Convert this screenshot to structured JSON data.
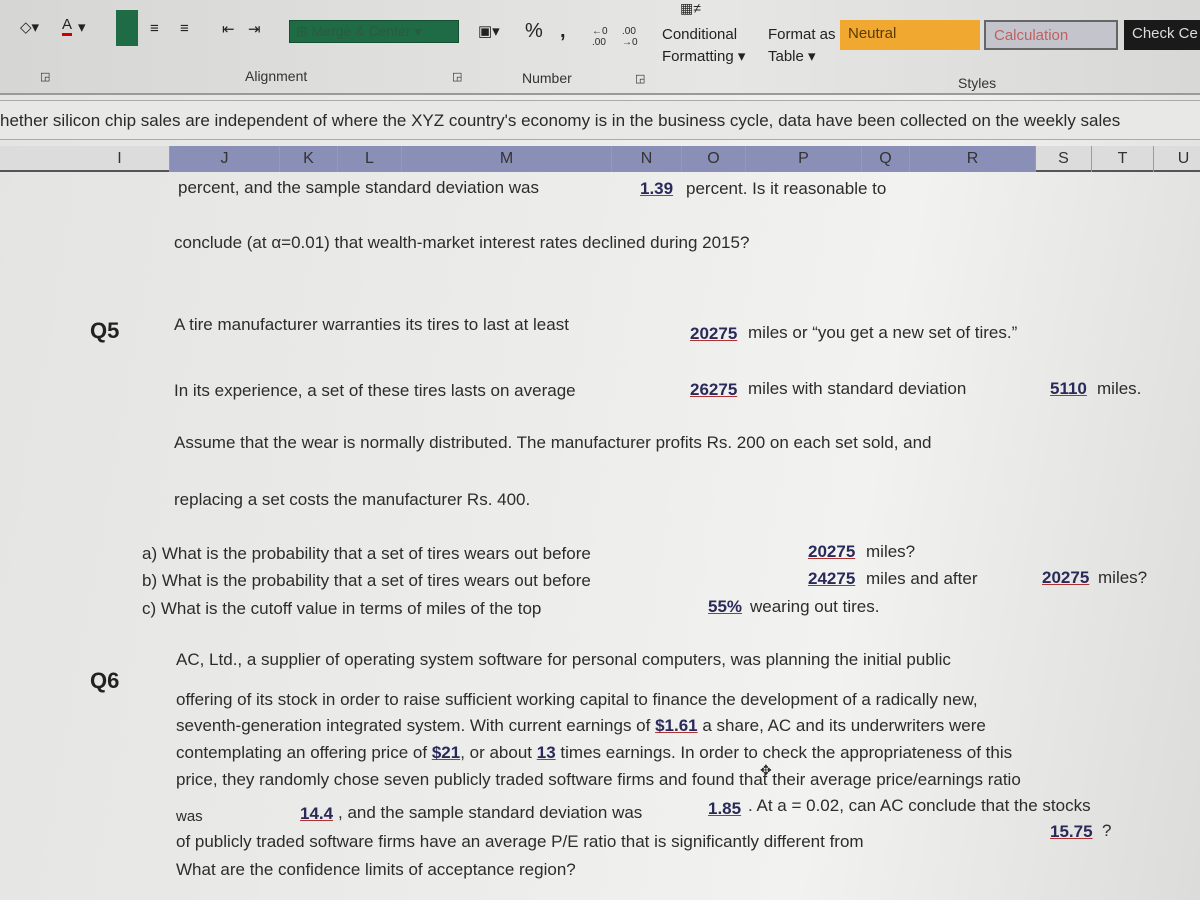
{
  "ribbon": {
    "merge_center": "Merge & Center",
    "percent": "%",
    "comma": ",",
    "conditional_formatting": [
      "Conditional",
      "Formatting"
    ],
    "format_as_table": [
      "Format as",
      "Table"
    ],
    "styles": {
      "neutral": "Neutral",
      "calculation": "Calculation",
      "check_cell": "Check Ce"
    },
    "groups": {
      "alignment": "Alignment",
      "number": "Number",
      "styles": "Styles"
    },
    "colors": {
      "neutral": "#f0a830",
      "calculation": "#c4c4cc",
      "check": "#1a1a1a",
      "merge": "#1f6b45"
    }
  },
  "formula_bar": {
    "text": "hether silicon chip sales are independent of where the XYZ country's economy is in the business cycle, data have been collected on the weekly sales"
  },
  "columns": [
    "I",
    "J",
    "K",
    "L",
    "M",
    "N",
    "O",
    "P",
    "Q",
    "R",
    "S",
    "T",
    "U"
  ],
  "sheet": {
    "l1a": "percent, and the sample standard deviation was",
    "l1v": "1.39",
    "l1b": "percent. Is it reasonable to",
    "l2": "conclude (at α=0.01) that wealth-market interest rates declined during 2015?",
    "q5": "Q5",
    "q5l1": "A tire manufacturer warranties its tires to last at least",
    "q5v1": "20275",
    "q5l1b": "miles or “you get a new set of tires.”",
    "q5l2": "In its experience, a set of these tires lasts on average",
    "q5v2": "26275",
    "q5l2b": "miles with standard deviation",
    "q5v3": "5110",
    "q5l2c": "miles.",
    "q5l3": "Assume that the wear is normally distributed. The manufacturer profits Rs. 200 on  each set sold, and",
    "q5l4": "replacing a set costs the manufacturer Rs. 400.",
    "qa": "a) What is the probability that a set of tires wears out before",
    "qav": "20275",
    "qab": "miles?",
    "qb": "b) What is the probability that a set of tires wears out before",
    "qbv": "24275",
    "qbb": "miles and after",
    "qbv2": "20275",
    "qbc": "miles?",
    "qc": "c) What is the cutoff value in terms of miles of the top",
    "qcv": "55%",
    "qcb": "wearing out tires.",
    "q6": "Q6",
    "q6l1": "AC, Ltd., a supplier of operating system software for personal computers, was planning the initial public",
    "q6l2": "offering of its stock in order to raise sufficient working capital to finance the development of a radically new,",
    "q6l3a": "seventh-generation integrated system. With current earnings of",
    "q6l3v": "$1.61",
    "q6l3b": "a share, AC and its underwriters were",
    "q6l4a": "contemplating an offering price of",
    "q6l4v": "$21",
    "q6l4b": ", or about",
    "q6l4v2": "13",
    "q6l4c": "times earnings. In order to check the appropriateness of this",
    "q6l5": "price, they randomly chose seven publicly traded software firms and found that their average price/earnings ratio",
    "q6l6a": "was",
    "q6l6v": "14.4",
    "q6l6b": ", and the sample standard deviation was",
    "q6l6v2": "1.85",
    "q6l6c": ". At a = 0.02, can AC conclude that the stocks",
    "q6l7a": "of publicly traded software firms have an average P/E ratio that is significantly different from",
    "q6l7v": "15.75",
    "q6l7b": "?",
    "q6l8": "What are the confidence limits of acceptance region?"
  }
}
